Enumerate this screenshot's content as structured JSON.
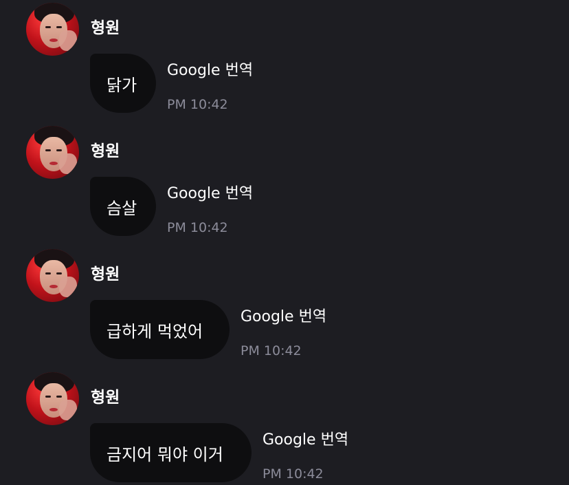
{
  "messages": [
    {
      "sender": "형원",
      "text": "닭가",
      "action": "Google 번역",
      "time": "PM 10:42"
    },
    {
      "sender": "형원",
      "text": "슴살",
      "action": "Google 번역",
      "time": "PM 10:42"
    },
    {
      "sender": "형원",
      "text": "급하게 먹었어",
      "action": "Google 번역",
      "time": "PM 10:42"
    },
    {
      "sender": "형원",
      "text": "금지어 뭐야 이거",
      "action": "Google 번역",
      "time": "PM 10:42"
    }
  ],
  "colors": {
    "background": "#1d1d22",
    "bubble": "#0e0e10",
    "text": "#ffffff",
    "timestamp": "#8c8c9a"
  }
}
